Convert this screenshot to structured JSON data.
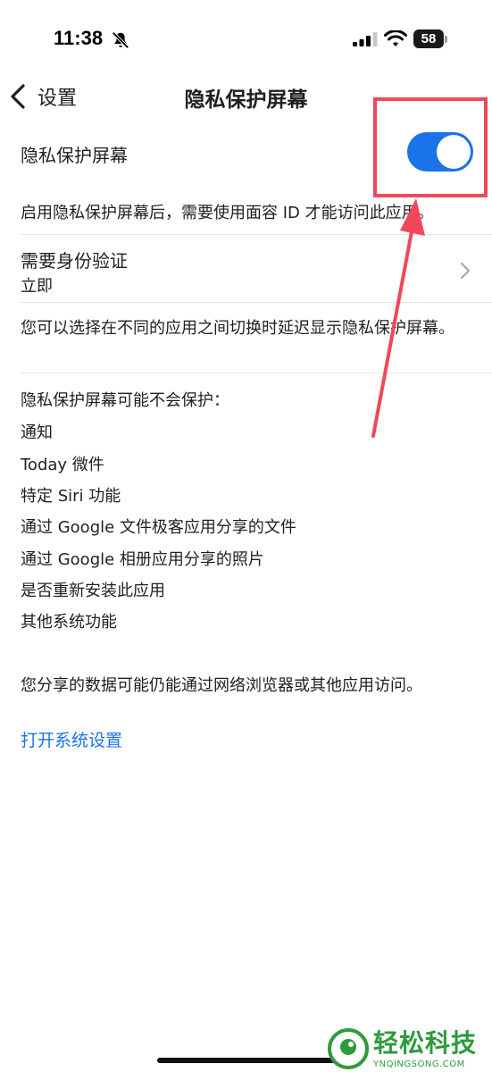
{
  "status_bar": {
    "time": "11:38",
    "battery": "58",
    "icons": [
      "bell-slash-icon",
      "cellular-signal-icon",
      "wifi-icon",
      "battery-icon"
    ]
  },
  "nav": {
    "back_label": "设置",
    "title": "隐私保护屏幕"
  },
  "privacy_toggle": {
    "label": "隐私保护屏幕",
    "enabled": true,
    "description": "启用隐私保护屏幕后，需要使用面容 ID 才能访问此应用。"
  },
  "auth": {
    "label": "需要身份验证",
    "value": "立即",
    "description": "您可以选择在不同的应用之间切换时延迟显示隐私保护屏幕。"
  },
  "not_protected": {
    "heading": "隐私保护屏幕可能不会保护：",
    "items": [
      "通知",
      "Today 微件",
      "特定 Siri 功能",
      "通过 Google 文件极客应用分享的文件",
      "通过 Google 相册应用分享的照片",
      "是否重新安装此应用",
      "其他系统功能"
    ]
  },
  "shared_note": "您分享的数据可能仍能通过网络浏览器或其他应用访问。",
  "open_settings_link": "打开系统设置",
  "watermark": {
    "name": "轻松科技",
    "domain": "YNQINGSONG.COM"
  },
  "colors": {
    "accent": "#1a73e8",
    "annotation": "#f0475a",
    "watermark": "#2e9a3c"
  }
}
